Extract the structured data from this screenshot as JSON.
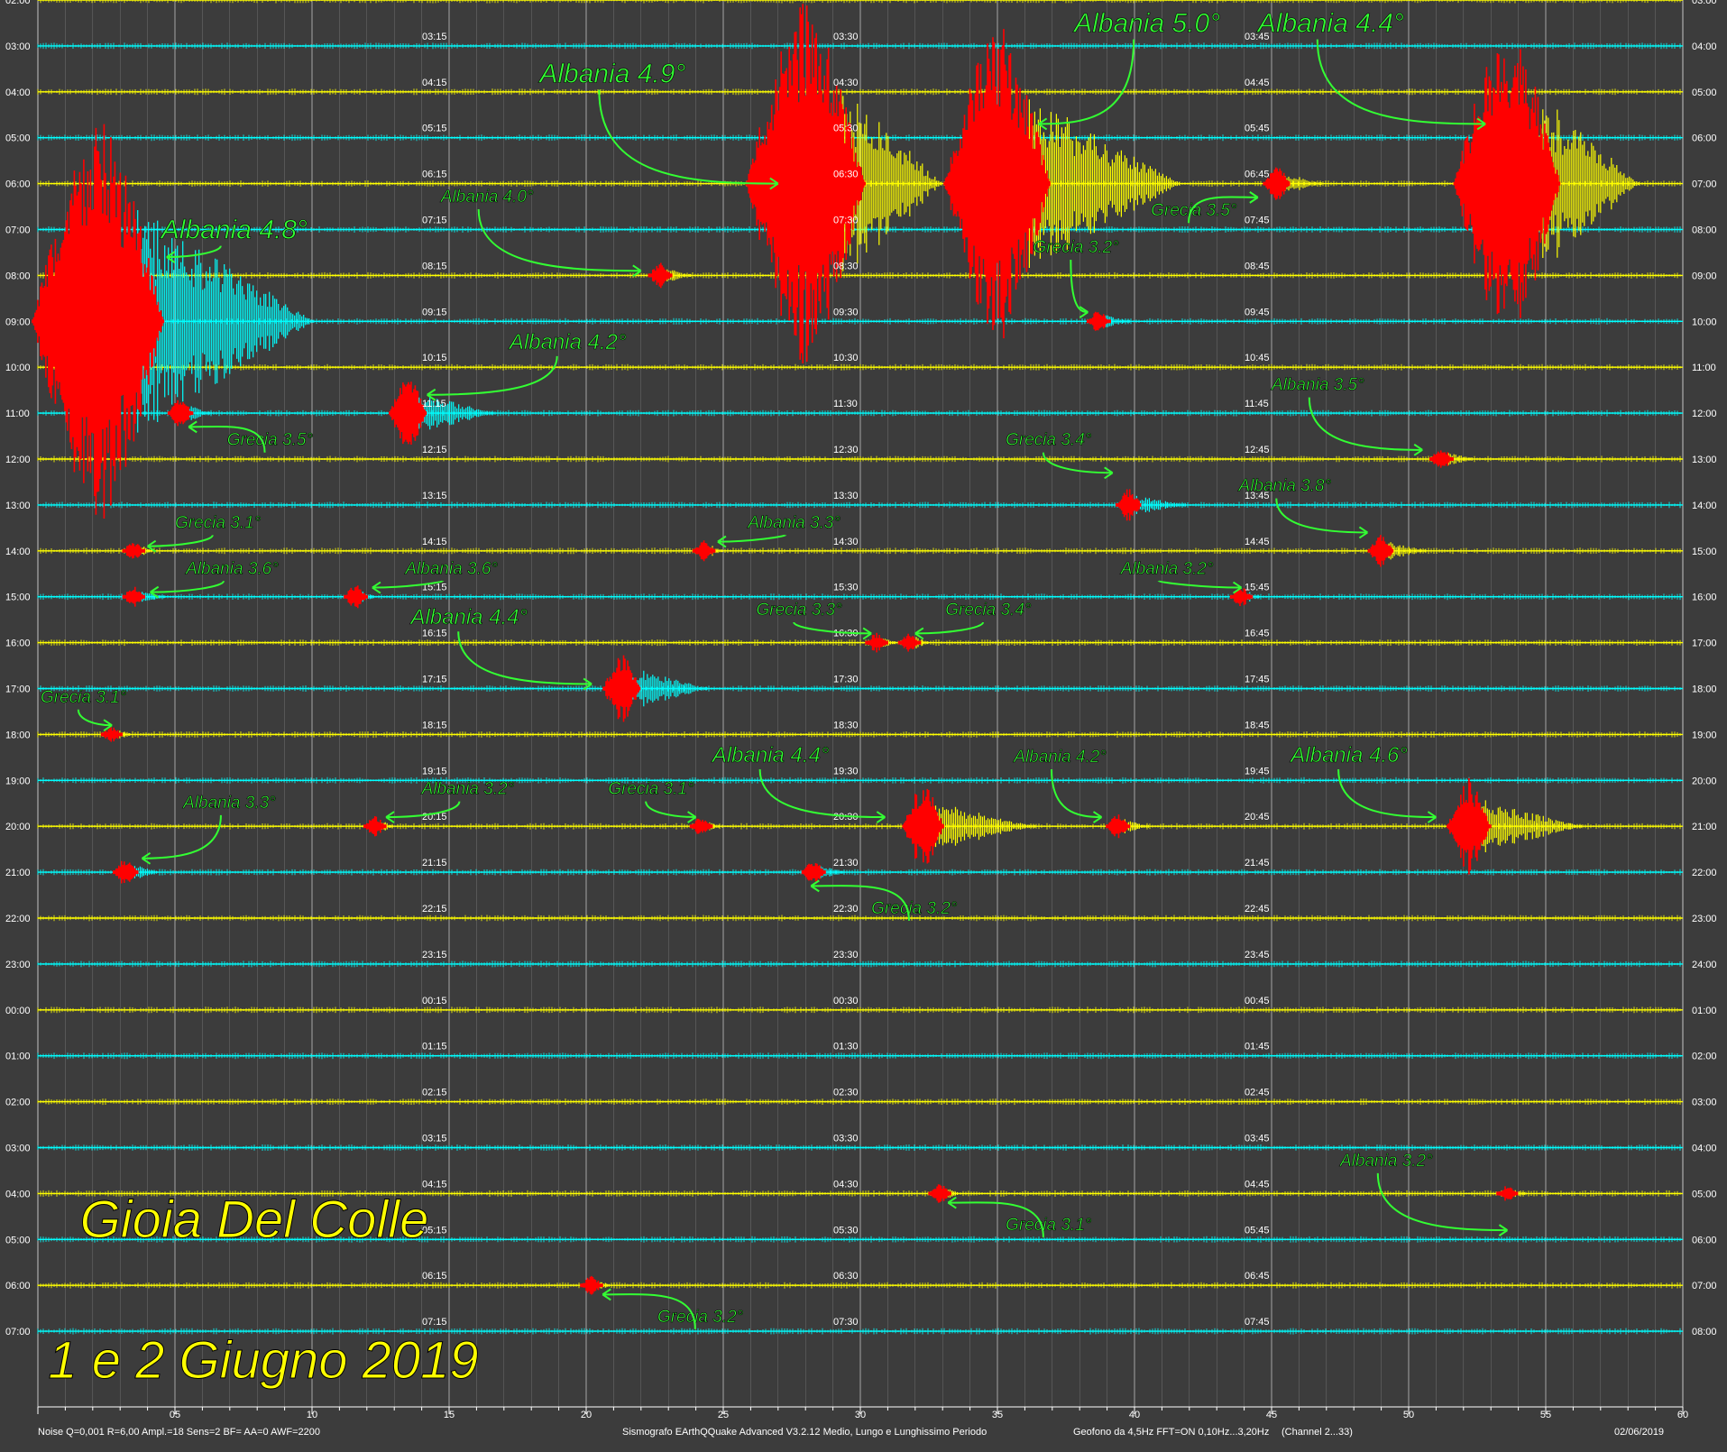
{
  "colors": {
    "background": "#3c3c3c",
    "trace_yellow": "#ffff00",
    "trace_cyan": "#00ffff",
    "event_red": "#ff0000",
    "annotation_green": "#33ff33",
    "grid": "#ffffff"
  },
  "chart_data": {
    "type": "helicorder",
    "x_axis": {
      "unit": "minutes",
      "range": [
        0,
        60
      ],
      "ticks": [
        5,
        10,
        15,
        20,
        25,
        30,
        35,
        40,
        45,
        50,
        55,
        60
      ],
      "tick_labels": [
        "05",
        "10",
        "15",
        "20",
        "25",
        "30",
        "35",
        "40",
        "45",
        "50",
        "55",
        "60"
      ]
    },
    "rows": [
      {
        "left": "02:00",
        "right": "03:00",
        "m15": "02:15",
        "m30": "02:30",
        "m45": "02:45",
        "color": "yellow"
      },
      {
        "left": "03:00",
        "right": "04:00",
        "m15": "03:15",
        "m30": "03:30",
        "m45": "03:45",
        "color": "cyan"
      },
      {
        "left": "04:00",
        "right": "05:00",
        "m15": "04:15",
        "m30": "04:30",
        "m45": "04:45",
        "color": "yellow"
      },
      {
        "left": "05:00",
        "right": "06:00",
        "m15": "05:15",
        "m30": "05:30",
        "m45": "05:45",
        "color": "cyan"
      },
      {
        "left": "06:00",
        "right": "07:00",
        "m15": "06:15",
        "m30": "06:30",
        "m45": "06:45",
        "color": "yellow"
      },
      {
        "left": "07:00",
        "right": "08:00",
        "m15": "07:15",
        "m30": "07:30",
        "m45": "07:45",
        "color": "cyan"
      },
      {
        "left": "08:00",
        "right": "09:00",
        "m15": "08:15",
        "m30": "08:30",
        "m45": "08:45",
        "color": "yellow"
      },
      {
        "left": "09:00",
        "right": "10:00",
        "m15": "09:15",
        "m30": "09:30",
        "m45": "09:45",
        "color": "cyan"
      },
      {
        "left": "10:00",
        "right": "11:00",
        "m15": "10:15",
        "m30": "10:30",
        "m45": "10:45",
        "color": "yellow"
      },
      {
        "left": "11:00",
        "right": "12:00",
        "m15": "11:15",
        "m30": "11:30",
        "m45": "11:45",
        "color": "cyan"
      },
      {
        "left": "12:00",
        "right": "13:00",
        "m15": "12:15",
        "m30": "12:30",
        "m45": "12:45",
        "color": "yellow"
      },
      {
        "left": "13:00",
        "right": "14:00",
        "m15": "13:15",
        "m30": "13:30",
        "m45": "13:45",
        "color": "cyan"
      },
      {
        "left": "14:00",
        "right": "15:00",
        "m15": "14:15",
        "m30": "14:30",
        "m45": "14:45",
        "color": "yellow"
      },
      {
        "left": "15:00",
        "right": "16:00",
        "m15": "15:15",
        "m30": "15:30",
        "m45": "15:45",
        "color": "cyan"
      },
      {
        "left": "16:00",
        "right": "17:00",
        "m15": "16:15",
        "m30": "16:30",
        "m45": "16:45",
        "color": "yellow"
      },
      {
        "left": "17:00",
        "right": "18:00",
        "m15": "17:15",
        "m30": "17:30",
        "m45": "17:45",
        "color": "cyan"
      },
      {
        "left": "18:00",
        "right": "19:00",
        "m15": "18:15",
        "m30": "18:30",
        "m45": "18:45",
        "color": "yellow"
      },
      {
        "left": "19:00",
        "right": "20:00",
        "m15": "19:15",
        "m30": "19:30",
        "m45": "19:45",
        "color": "cyan"
      },
      {
        "left": "20:00",
        "right": "21:00",
        "m15": "20:15",
        "m30": "20:30",
        "m45": "20:45",
        "color": "yellow"
      },
      {
        "left": "21:00",
        "right": "22:00",
        "m15": "21:15",
        "m30": "21:30",
        "m45": "21:45",
        "color": "cyan"
      },
      {
        "left": "22:00",
        "right": "23:00",
        "m15": "22:15",
        "m30": "22:30",
        "m45": "22:45",
        "color": "yellow"
      },
      {
        "left": "23:00",
        "right": "24:00",
        "m15": "23:15",
        "m30": "23:30",
        "m45": "23:45",
        "color": "cyan"
      },
      {
        "left": "00:00",
        "right": "01:00",
        "m15": "00:15",
        "m30": "00:30",
        "m45": "00:45",
        "color": "yellow"
      },
      {
        "left": "01:00",
        "right": "02:00",
        "m15": "01:15",
        "m30": "01:30",
        "m45": "01:45",
        "color": "cyan"
      },
      {
        "left": "02:00",
        "right": "03:00",
        "m15": "02:15",
        "m30": "02:30",
        "m45": "02:45",
        "color": "yellow"
      },
      {
        "left": "03:00",
        "right": "04:00",
        "m15": "03:15",
        "m30": "03:30",
        "m45": "03:45",
        "color": "cyan"
      },
      {
        "left": "04:00",
        "right": "05:00",
        "m15": "04:15",
        "m30": "04:30",
        "m45": "04:45",
        "color": "yellow"
      },
      {
        "left": "05:00",
        "right": "06:00",
        "m15": "05:15",
        "m30": "05:30",
        "m45": "05:45",
        "color": "cyan"
      },
      {
        "left": "06:00",
        "right": "07:00",
        "m15": "06:15",
        "m30": "06:30",
        "m45": "06:45",
        "color": "yellow"
      },
      {
        "left": "07:00",
        "right": "08:00",
        "m15": "07:15",
        "m30": "07:30",
        "m45": "07:45",
        "color": "cyan"
      }
    ],
    "events": [
      {
        "label": "Albania 4.8°",
        "row": 7,
        "minute": 2.2,
        "amplitude": 9,
        "tail": 7,
        "tail_color": "cyan",
        "label_at": [
          4.5,
          5.2
        ],
        "arrow_to": [
          4.7,
          5.6
        ]
      },
      {
        "label": "Albania 4.0°",
        "row": 6,
        "minute": 22.7,
        "amplitude": 0.4,
        "tail": 1,
        "label_at": [
          14.7,
          4.4
        ],
        "arrow_to": [
          22,
          5.9
        ]
      },
      {
        "label": "Albania 4.9°",
        "row": 4,
        "minute": 28.0,
        "amplitude": 8,
        "tail": 4,
        "label_at": [
          18.3,
          1.8
        ],
        "arrow_to": [
          27,
          4
        ]
      },
      {
        "label": "Albania 5.0°",
        "row": 4,
        "minute": 35.0,
        "amplitude": 7,
        "tail": 6,
        "label_at": [
          37.8,
          0.7
        ],
        "arrow_to": [
          36.5,
          2.7
        ]
      },
      {
        "label": "Albania 4.4°",
        "row": 4,
        "minute": 53.6,
        "amplitude": 7,
        "tail": 4,
        "label_at": [
          44.5,
          0.7
        ],
        "arrow_to": [
          52.8,
          2.7
        ]
      },
      {
        "label": "Grecia 3.5°",
        "row": 4,
        "minute": 45.2,
        "amplitude": 0.7,
        "tail": 1.5,
        "label_at": [
          40.6,
          4.7
        ],
        "arrow_to": [
          44.5,
          4.3
        ]
      },
      {
        "label": "Grecia 3.2°",
        "row": 7,
        "minute": 38.7,
        "amplitude": 0.4,
        "tail": 1,
        "label_at": [
          36.3,
          5.5
        ],
        "arrow_to": [
          38.3,
          6.8
        ]
      },
      {
        "label": "Albania 4.2°",
        "row": 9,
        "minute": 13.5,
        "amplitude": 1.5,
        "tail": 3,
        "tail_color": "cyan",
        "label_at": [
          17.2,
          7.6
        ],
        "arrow_to": [
          14.2,
          8.6
        ]
      },
      {
        "label": "Grecia 3.5°",
        "row": 9,
        "minute": 5.2,
        "amplitude": 0.5,
        "tail": 1,
        "label_at": [
          6.9,
          9.7
        ],
        "arrow_to": [
          5.5,
          9.3
        ]
      },
      {
        "label": "Albania 3.5°",
        "row": 10,
        "minute": 51.2,
        "amplitude": 0.4,
        "tail": 1,
        "label_at": [
          45.0,
          8.5
        ],
        "arrow_to": [
          50.5,
          9.8
        ]
      },
      {
        "label": "Grecia 3.4°",
        "row": 11,
        "minute": 39.8,
        "amplitude": 0.6,
        "tail": 2,
        "label_at": [
          35.3,
          9.7
        ],
        "arrow_to": [
          39.2,
          10.3
        ]
      },
      {
        "label": "Albania 3.8°",
        "row": 12,
        "minute": 49.0,
        "amplitude": 0.6,
        "tail": 1.5,
        "label_at": [
          43.8,
          10.7
        ],
        "arrow_to": [
          48.5,
          11.6
        ]
      },
      {
        "label": "Grecia 3.1°",
        "row": 12,
        "minute": 3.5,
        "amplitude": 0.3,
        "tail": 0.5,
        "label_at": [
          5.0,
          11.5
        ],
        "arrow_to": [
          4.0,
          11.9
        ]
      },
      {
        "label": "Albania 3.3°",
        "row": 12,
        "minute": 24.3,
        "amplitude": 0.3,
        "tail": 0.5,
        "label_at": [
          25.9,
          11.5
        ],
        "arrow_to": [
          24.8,
          11.8
        ]
      },
      {
        "label": "Albania 3.6°",
        "row": 13,
        "minute": 3.5,
        "amplitude": 0.3,
        "tail": 1,
        "label_at": [
          5.4,
          12.5
        ],
        "arrow_to": [
          4.1,
          12.9
        ]
      },
      {
        "label": "Albania 3.6°",
        "row": 13,
        "minute": 11.6,
        "amplitude": 0.4,
        "tail": 0.5,
        "label_at": [
          13.4,
          12.5
        ],
        "arrow_to": [
          12.2,
          12.8
        ]
      },
      {
        "label": "Albania 3.2°",
        "row": 13,
        "minute": 43.9,
        "amplitude": 0.3,
        "tail": 0.5,
        "label_at": [
          39.5,
          12.5
        ],
        "arrow_to": [
          43.9,
          12.8
        ]
      },
      {
        "label": "Grecia 3.3°",
        "row": 14,
        "minute": 30.6,
        "amplitude": 0.3,
        "tail": 0.5,
        "label_at": [
          26.2,
          13.4
        ],
        "arrow_to": [
          30.4,
          13.8
        ]
      },
      {
        "label": "Grecia 3.4°",
        "row": 14,
        "minute": 31.8,
        "amplitude": 0.3,
        "tail": 0.5,
        "label_at": [
          33.1,
          13.4
        ],
        "arrow_to": [
          32.0,
          13.8
        ]
      },
      {
        "label": "Albania 4.4°",
        "row": 15,
        "minute": 21.3,
        "amplitude": 1.5,
        "tail": 3,
        "tail_color": "cyan",
        "label_at": [
          13.6,
          13.6
        ],
        "arrow_to": [
          20.2,
          14.9
        ]
      },
      {
        "label": "Grecia 3.1°",
        "row": 16,
        "minute": 2.7,
        "amplitude": 0.2,
        "tail": 0.5,
        "label_at": [
          0.1,
          15.3
        ],
        "arrow_to": [
          2.7,
          15.8
        ]
      },
      {
        "label": "Albania 3.3°",
        "row": 19,
        "minute": 3.2,
        "amplitude": 0.5,
        "tail": 1,
        "label_at": [
          5.3,
          17.6
        ],
        "arrow_to": [
          3.8,
          18.7
        ]
      },
      {
        "label": "Albania 3.2°",
        "row": 18,
        "minute": 12.3,
        "amplitude": 0.3,
        "tail": 0.5,
        "label_at": [
          14.0,
          17.3
        ],
        "arrow_to": [
          12.7,
          17.8
        ]
      },
      {
        "label": "Grecia 3.1°",
        "row": 18,
        "minute": 24.2,
        "amplitude": 0.3,
        "tail": 0.5,
        "label_at": [
          20.8,
          17.3
        ],
        "arrow_to": [
          24.0,
          17.8
        ]
      },
      {
        "label": "Albania 4.4°",
        "row": 18,
        "minute": 32.3,
        "amplitude": 1.8,
        "tail": 4,
        "label_at": [
          24.6,
          16.6
        ],
        "arrow_to": [
          30.9,
          17.8
        ]
      },
      {
        "label": "Albania 4.2°",
        "row": 18,
        "minute": 39.4,
        "amplitude": 0.4,
        "tail": 1,
        "label_at": [
          35.6,
          16.6
        ],
        "arrow_to": [
          38.8,
          17.8
        ]
      },
      {
        "label": "Albania 4.6°",
        "row": 18,
        "minute": 52.2,
        "amplitude": 2,
        "tail": 4,
        "label_at": [
          45.7,
          16.6
        ],
        "arrow_to": [
          51.0,
          17.8
        ]
      },
      {
        "label": "Grecia 3.2°",
        "row": 19,
        "minute": 28.3,
        "amplitude": 0.4,
        "tail": 1,
        "label_at": [
          30.4,
          19.9
        ],
        "arrow_to": [
          28.2,
          19.3
        ]
      },
      {
        "label": "Grecia 3.1°",
        "row": 26,
        "minute": 32.9,
        "amplitude": 0.3,
        "tail": 0.5,
        "label_at": [
          35.3,
          26.8
        ],
        "arrow_to": [
          33.2,
          26.2
        ]
      },
      {
        "label": "Albania 3.2°",
        "row": 26,
        "minute": 53.6,
        "amplitude": 0.2,
        "tail": 0.5,
        "label_at": [
          47.5,
          25.4
        ],
        "arrow_to": [
          53.6,
          26.8
        ]
      },
      {
        "label": "Grecia 3.2°",
        "row": 28,
        "minute": 20.2,
        "amplitude": 0.3,
        "tail": 0.5,
        "label_at": [
          22.6,
          28.8
        ],
        "arrow_to": [
          20.6,
          28.2
        ]
      }
    ]
  },
  "title": {
    "line1": "Gioia Del Colle",
    "line2": "1 e 2 Giugno 2019"
  },
  "footer": {
    "left": "Noise Q=0,001 R=6,00 Ampl.=18 Sens=2 BF= AA=0 AWF=2200",
    "center": "Sismografo  EArthQQuake Advanced V3.2.12  Medio, Lungo e Lunghissimo Periodo",
    "right_info": "Geofono da 4,5Hz FFT=ON 0,10Hz...3,20Hz",
    "channel": "(Channel 2...33)",
    "date": "02/06/2019"
  }
}
